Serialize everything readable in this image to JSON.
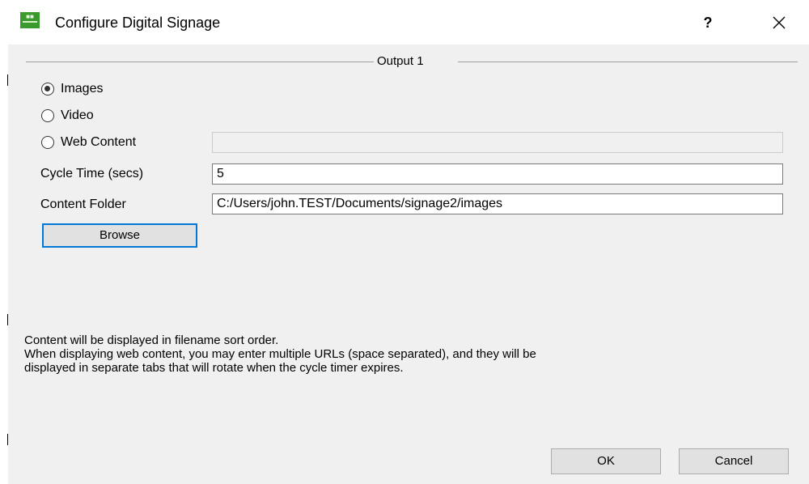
{
  "window": {
    "title": "Configure Digital Signage",
    "icon": "app-logo-icon",
    "help_label": "?",
    "close_icon": "close-icon"
  },
  "group": {
    "title": "Output 1"
  },
  "source_options": [
    {
      "label": "Images",
      "checked": true
    },
    {
      "label": "Video",
      "checked": false
    },
    {
      "label": "Web Content",
      "checked": false
    }
  ],
  "web_content": {
    "value": ""
  },
  "cycle_time": {
    "label": "Cycle Time (secs)",
    "value": "5"
  },
  "content_folder": {
    "label": "Content Folder",
    "value": "C:/Users/john.TEST/Documents/signage2/images"
  },
  "browse_label": "Browse",
  "info": {
    "line1": "Content will be displayed in filename sort order.",
    "line2": "When displaying web content, you may enter multiple URLs (space separated), and they will be",
    "line3": "displayed in separate tabs that will rotate when the cycle timer expires."
  },
  "buttons": {
    "ok": "OK",
    "cancel": "Cancel"
  },
  "colors": {
    "focus_border": "#0078d7",
    "dialog_bg": "#f0f0f0",
    "icon_green": "#3b9a2e"
  }
}
